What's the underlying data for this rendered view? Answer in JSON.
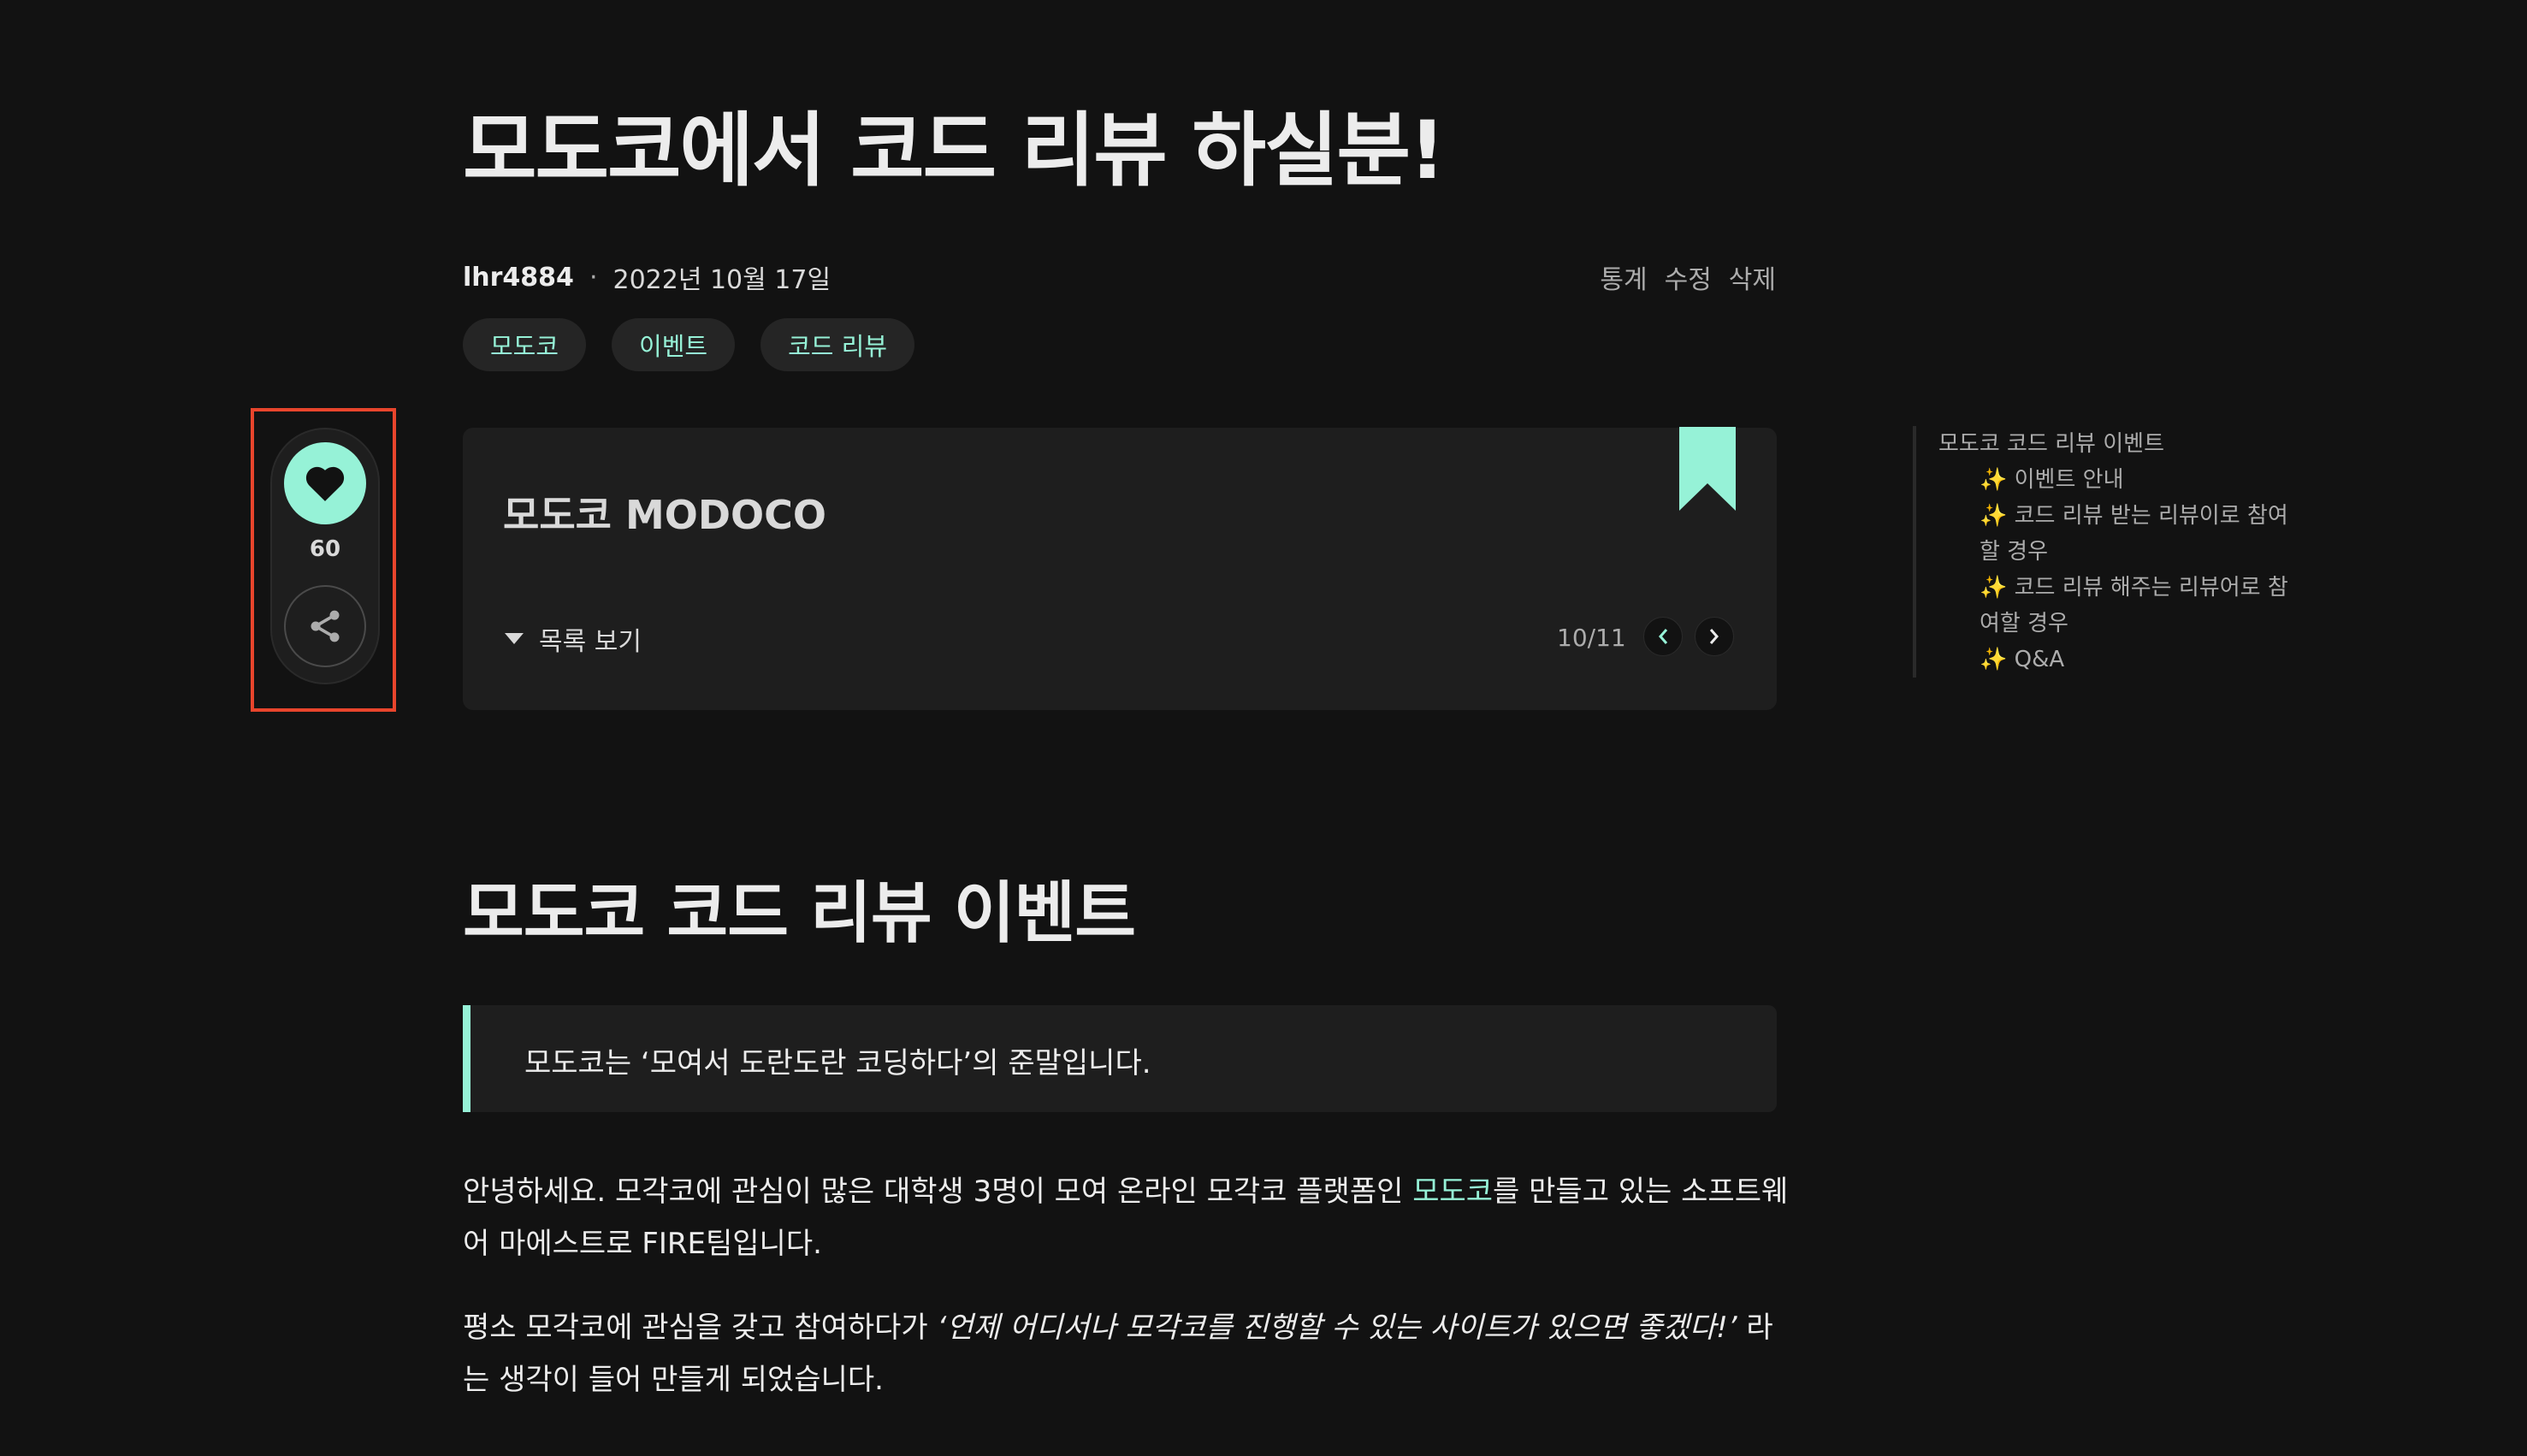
{
  "post": {
    "title": "모도코에서 코드 리뷰 하실분!",
    "author": "lhr4884",
    "separator": "·",
    "date": "2022년 10월 17일",
    "actions": {
      "stats": "통계",
      "edit": "수정",
      "delete": "삭제"
    },
    "tags": [
      "모도코",
      "이벤트",
      "코드 리뷰"
    ]
  },
  "float": {
    "like_count": "60",
    "like_icon": "heart-icon",
    "share_icon": "share-icon"
  },
  "series": {
    "title": "모도코 MODOCO",
    "toggle_label": "목록 보기",
    "page": "10/11"
  },
  "toc": {
    "items": [
      "모도코 코드 리뷰 이벤트",
      "✨ 이벤트 안내",
      "✨ 코드 리뷰 받는 리뷰이로 참여할 경우",
      "✨ 코드 리뷰 해주는 리뷰어로 참여할 경우",
      "✨ Q&A"
    ]
  },
  "content": {
    "heading": "모도코 코드 리뷰 이벤트",
    "quote": "모도코는 ‘모여서 도란도란 코딩하다’의 준말입니다.",
    "para1_a": "안녕하세요. 모각코에 관심이 많은 대학생 3명이 모여 온라인 모각코 플랫폼인 ",
    "para1_link": "모도코",
    "para1_b": "를 만들고 있는 소프트웨어 마에스트로 FIRE팀입니다.",
    "para2_a": "평소 모각코에 관심을 갖고 참여하다가 ",
    "para2_em": "‘언제 어디서나 모각코를 진행할 수 있는 사이트가 있으면 좋겠다!’",
    "para2_b": " 라는 생각이 들어 만들게 되었습니다."
  },
  "colors": {
    "background": "#121212",
    "accent": "#96f2d7",
    "card": "#1e1e1e",
    "highlight": "#e8452c"
  }
}
